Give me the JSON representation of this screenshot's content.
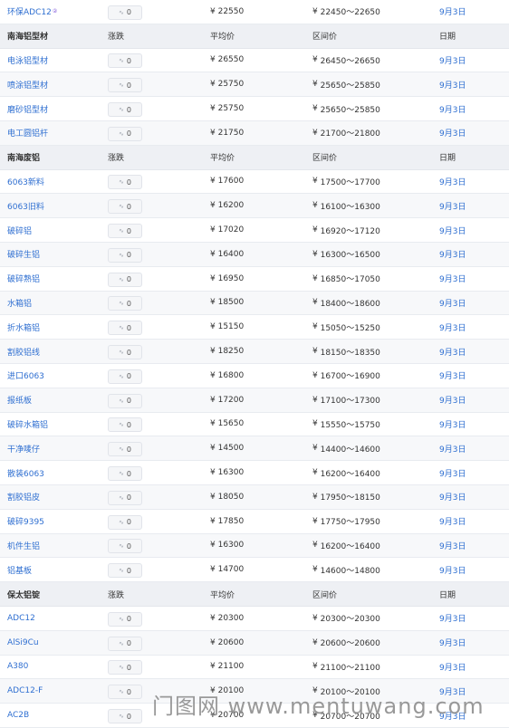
{
  "currency_symbol": "¥",
  "change_icon": "trend-icon",
  "sections": [
    {
      "header": null,
      "rows": [
        {
          "name": "环保ADC12",
          "superscript": "②",
          "change": "0",
          "avg": "22550",
          "range": "22450～22650",
          "date": "9月3日"
        }
      ]
    },
    {
      "header": {
        "name": "南海铝型材",
        "change": "涨跌",
        "avg": "平均价",
        "range": "区间价",
        "date": "日期"
      },
      "rows": [
        {
          "name": "电泳铝型材",
          "change": "0",
          "avg": "26550",
          "range": "26450～26650",
          "date": "9月3日"
        },
        {
          "name": "喷涂铝型材",
          "change": "0",
          "avg": "25750",
          "range": "25650～25850",
          "date": "9月3日"
        },
        {
          "name": "磨砂铝型材",
          "change": "0",
          "avg": "25750",
          "range": "25650～25850",
          "date": "9月3日"
        },
        {
          "name": "电工圆铝杆",
          "change": "0",
          "avg": "21750",
          "range": "21700～21800",
          "date": "9月3日"
        }
      ]
    },
    {
      "header": {
        "name": "南海废铝",
        "change": "涨跌",
        "avg": "平均价",
        "range": "区间价",
        "date": "日期"
      },
      "rows": [
        {
          "name": "6063新料",
          "change": "0",
          "avg": "17600",
          "range": "17500～17700",
          "date": "9月3日"
        },
        {
          "name": "6063旧料",
          "change": "0",
          "avg": "16200",
          "range": "16100～16300",
          "date": "9月3日"
        },
        {
          "name": "破碎铝",
          "change": "0",
          "avg": "17020",
          "range": "16920～17120",
          "date": "9月3日"
        },
        {
          "name": "破碎生铝",
          "change": "0",
          "avg": "16400",
          "range": "16300～16500",
          "date": "9月3日"
        },
        {
          "name": "破碎熟铝",
          "change": "0",
          "avg": "16950",
          "range": "16850～17050",
          "date": "9月3日"
        },
        {
          "name": "水箱铝",
          "change": "0",
          "avg": "18500",
          "range": "18400～18600",
          "date": "9月3日"
        },
        {
          "name": "折水箱铝",
          "change": "0",
          "avg": "15150",
          "range": "15050～15250",
          "date": "9月3日"
        },
        {
          "name": "割胶铝线",
          "change": "0",
          "avg": "18250",
          "range": "18150～18350",
          "date": "9月3日"
        },
        {
          "name": "进口6063",
          "change": "0",
          "avg": "16800",
          "range": "16700～16900",
          "date": "9月3日"
        },
        {
          "name": "报纸板",
          "change": "0",
          "avg": "17200",
          "range": "17100～17300",
          "date": "9月3日"
        },
        {
          "name": "破碎水箱铝",
          "change": "0",
          "avg": "15650",
          "range": "15550～15750",
          "date": "9月3日"
        },
        {
          "name": "干净唛仔",
          "change": "0",
          "avg": "14500",
          "range": "14400～14600",
          "date": "9月3日"
        },
        {
          "name": "散装6063",
          "change": "0",
          "avg": "16300",
          "range": "16200～16400",
          "date": "9月3日"
        },
        {
          "name": "割胶铝皮",
          "change": "0",
          "avg": "18050",
          "range": "17950～18150",
          "date": "9月3日"
        },
        {
          "name": "破碎9395",
          "change": "0",
          "avg": "17850",
          "range": "17750～17950",
          "date": "9月3日"
        },
        {
          "name": "机件生铝",
          "change": "0",
          "avg": "16300",
          "range": "16200～16400",
          "date": "9月3日"
        },
        {
          "name": "铝基板",
          "change": "0",
          "avg": "14700",
          "range": "14600～14800",
          "date": "9月3日"
        }
      ]
    },
    {
      "header": {
        "name": "保太铝锭",
        "change": "涨跌",
        "avg": "平均价",
        "range": "区间价",
        "date": "日期"
      },
      "rows": [
        {
          "name": "ADC12",
          "change": "0",
          "avg": "20300",
          "range": "20300～20300",
          "date": "9月3日"
        },
        {
          "name": "AlSi9Cu",
          "change": "0",
          "avg": "20600",
          "range": "20600～20600",
          "date": "9月3日"
        },
        {
          "name": "A380",
          "change": "0",
          "avg": "21100",
          "range": "21100～21100",
          "date": "9月3日"
        },
        {
          "name": "ADC12-F",
          "change": "0",
          "avg": "20100",
          "range": "20100～20100",
          "date": "9月3日"
        },
        {
          "name": "AC2B",
          "change": "0",
          "avg": "20700",
          "range": "20700～20700",
          "date": "9月3日"
        }
      ]
    }
  ],
  "watermark": "门图网 www.mentuwang.com"
}
